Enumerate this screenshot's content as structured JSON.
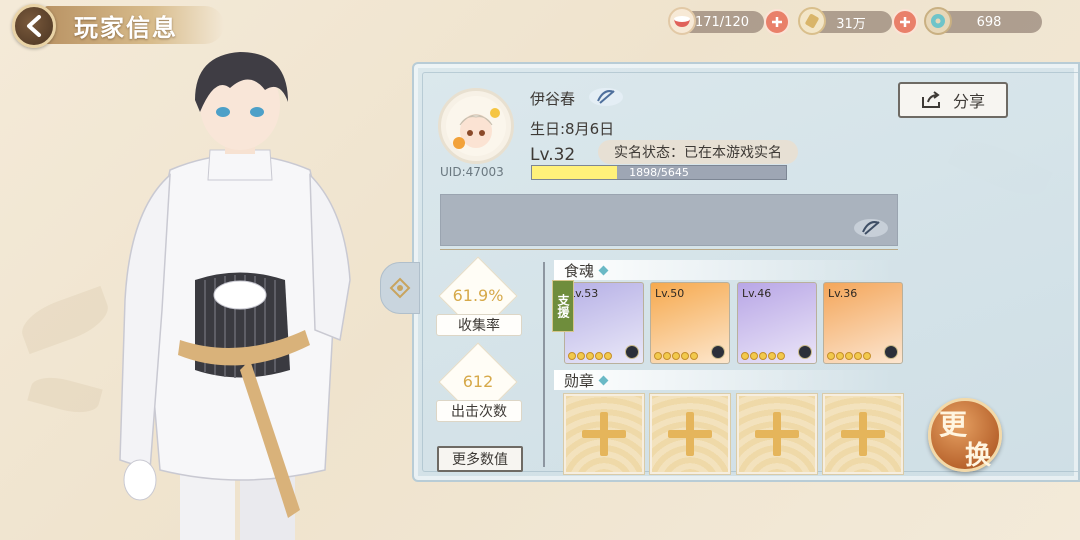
{
  "header": {
    "title": "玩家信息"
  },
  "resources": [
    {
      "icon": "rice-bowl-icon",
      "value": "171/120"
    },
    {
      "icon": "scroll-icon",
      "value": "31万"
    },
    {
      "icon": "jade-coin-icon",
      "value": "698"
    }
  ],
  "profile": {
    "name": "伊谷春",
    "birthday": "生日:8月6日",
    "level": "Lv.32",
    "realname_status": "实名状态：已在本游戏实名",
    "exp_text": "1898/5645",
    "exp_fraction": 0.336,
    "uid": "UID:47003"
  },
  "share": {
    "label": "分享"
  },
  "stats": {
    "collection_rate": "61.9%",
    "collection_label": "收集率",
    "sorties": "612",
    "sorties_label": "出击次数",
    "more_label": "更多数值"
  },
  "sections": {
    "souls": "食魂",
    "medals": "勋章"
  },
  "support_tag": "支援",
  "cards": [
    {
      "level": "Lv.53",
      "bg": "#b6b0e6",
      "support": true
    },
    {
      "level": "Lv.50",
      "bg": "#f6a94e",
      "support": false
    },
    {
      "level": "Lv.46",
      "bg": "#b8a6e6",
      "support": false
    },
    {
      "level": "Lv.36",
      "bg": "#f4a65a",
      "support": false
    }
  ],
  "swap": {
    "char1": "更",
    "char2": "换"
  },
  "colors": {
    "panel": "#d6e4ea",
    "accent_gold": "#d6a94a",
    "plus_red": "#e9806a"
  }
}
